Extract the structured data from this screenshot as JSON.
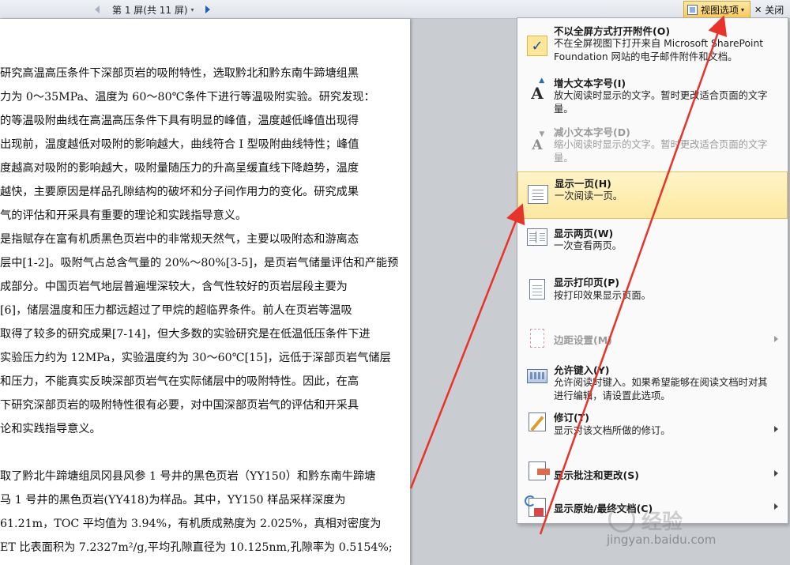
{
  "toolbar": {
    "page_indicator": "第 1 屏(共 11 屏)",
    "view_options_label": "视图选项",
    "close_label": "关闭"
  },
  "document": {
    "lines": [
      "研究高温高压条件下深部页岩的吸附特性，选取黔北和黔东南牛蹄塘组黑",
      "力为 0～35MPa、温度为 60～80℃条件下进行等温吸附实验。研究发现：",
      "的等温吸附曲线在高温高压条件下具有明显的峰值，温度越低峰值出现得",
      "出现前，温度越低对吸附的影响越大，曲线符合 I 型吸附曲线特性；峰值",
      "度越高对吸附的影响越大，吸附量随压力的升高呈缓直线下降趋势，温度",
      "越快，主要原因是样品孔隙结构的破坏和分子间作用力的变化。研究成果",
      "气的评估和开采具有重要的理论和实践指导意义。",
      "是指赋存在富有机质黑色页岩中的非常规天然气，主要以吸附态和游离态",
      "层中[1-2]。吸附气占总含气量的 20%～80%[3-5]，是页岩气储量评估和产能预",
      "成部分。中国页岩气地层普遍埋深较大，含气性较好的页岩层段主要为",
      "[6]，储层温度和压力都远超过了甲烷的超临界条件。前人在页岩等温吸",
      "取得了较多的研究成果[7-14]，但大多数的实验研究是在低温低压条件下进",
      "实验压力约为 12MPa，实验温度约为 30～60℃[15]，远低于深部页岩气储层",
      "和压力，不能真实反映深部页岩气在实际储层中的吸附特性。因此，在高",
      "下研究深部页岩的吸附特性很有必要，对中国深部页岩气的评估和开采具",
      "论和实践指导意义。",
      "取了黔北牛蹄塘组凤冈县风参 1 号井的黑色页岩（YY150）和黔东南牛蹄塘",
      "马 1 号井的黑色页岩(YY418)为样品。其中，YY150 样品采样深度为",
      "61.21m，TOC 平均值为 3.94%，有机质成熟度为 2.025%，真相对密度为",
      "ET 比表面积为 7.2327m²/g,平均孔隙直径为 10.125nm,孔隙率为 0.5154%;"
    ]
  },
  "menu": {
    "items": [
      {
        "title": "不以全屏方式打开附件(O)",
        "desc": "不在全屏视图下打开来自 Microsoft SharePoint Foundation 网站的电子邮件附件和文档。",
        "icon": "checkmark-icon"
      },
      {
        "title": "增大文本字号(I)",
        "desc": "放大阅读时显示的文字。暂时更改适合页面的文字量。",
        "icon": "increase-font-icon"
      },
      {
        "title": "减小文本字号(D)",
        "desc": "缩小阅读时显示的文字。暂时更改适合页面的文字量。",
        "icon": "decrease-font-icon"
      },
      {
        "title": "显示一页(H)",
        "desc": "一次阅读一页。",
        "icon": "single-page-icon"
      },
      {
        "title": "显示两页(W)",
        "desc": "一次查看两页。",
        "icon": "two-pages-icon"
      },
      {
        "title": "显示打印页(P)",
        "desc": "按打印效果显示页面。",
        "icon": "print-page-icon"
      },
      {
        "title": "边距设置(M)",
        "desc": "",
        "icon": "margins-icon"
      },
      {
        "title": "允许键入(Y)",
        "desc": "允许阅读时键入。如果希望能够在阅读文档时对其进行编辑，请设置此选项。",
        "icon": "keyboard-icon"
      },
      {
        "title": "修订(T)",
        "desc": "显示对该文档所做的修订。",
        "icon": "track-changes-icon"
      },
      {
        "title": "显示批注和更改(S)",
        "desc": "",
        "icon": "comments-icon"
      },
      {
        "title": "显示原始/最终文档(C)",
        "desc": "",
        "icon": "original-final-icon"
      }
    ]
  },
  "watermark": {
    "brand": "经验",
    "url": "jingyan.baidu.com"
  },
  "colors": {
    "highlight": "#fde8a0",
    "arrow": "#e8332a",
    "check": "#1d4f96"
  }
}
